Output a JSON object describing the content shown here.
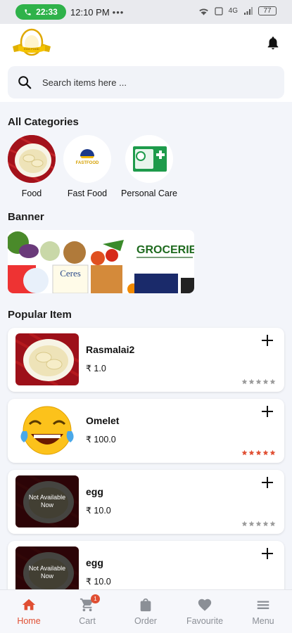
{
  "status_bar": {
    "call_time": "22:33",
    "time": "12:10 PM",
    "dots": "•••",
    "network": "4G",
    "battery": "77"
  },
  "search": {
    "placeholder": "Search items here ..."
  },
  "sections": {
    "categories": "All Categories",
    "banner": "Banner",
    "popular": "Popular Item"
  },
  "categories": [
    {
      "label": "Food"
    },
    {
      "label": "Fast Food"
    },
    {
      "label": "Personal Care"
    }
  ],
  "banner": {
    "text": "GROCERIE",
    "brand": "Ceres"
  },
  "items": [
    {
      "name": "Rasmalai2",
      "price": "₹ 1.0",
      "rating": 0
    },
    {
      "name": "Omelet",
      "price": "₹ 100.0",
      "rating": 5
    },
    {
      "name": "egg",
      "price": "₹ 10.0",
      "rating": 0,
      "overlay": "Not Available Now"
    },
    {
      "name": "egg",
      "price": "₹ 10.0",
      "rating": 0,
      "overlay": "Not Available Now"
    }
  ],
  "nav": [
    {
      "label": "Home",
      "active": true
    },
    {
      "label": "Cart",
      "badge": "1"
    },
    {
      "label": "Order"
    },
    {
      "label": "Favourite"
    },
    {
      "label": "Menu"
    }
  ],
  "colors": {
    "accent": "#e04f33",
    "star_active": "#e04f33",
    "star_inactive": "#9a9a9a",
    "call_green": "#2fb24a"
  }
}
